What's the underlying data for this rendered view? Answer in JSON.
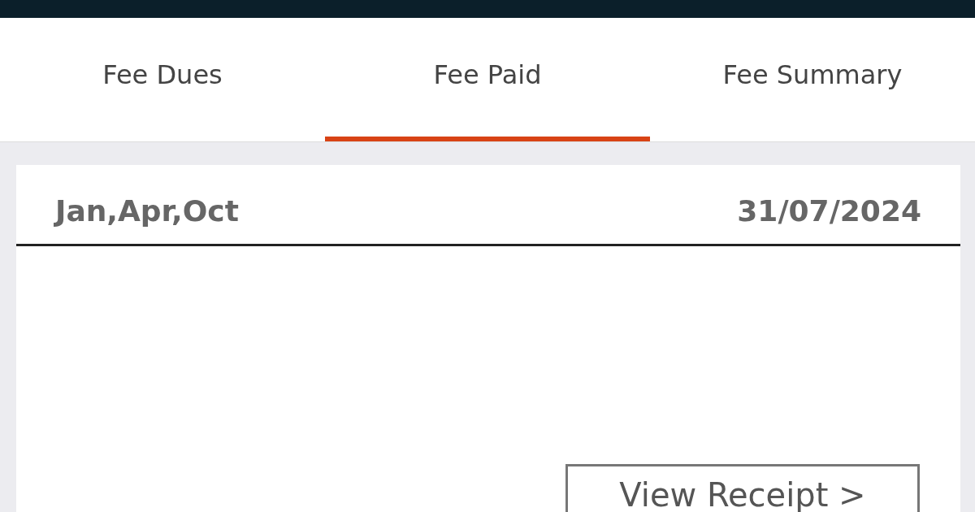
{
  "tabs": [
    {
      "label": "Fee Dues",
      "selected": false
    },
    {
      "label": "Fee Paid",
      "selected": true
    },
    {
      "label": "Fee Summary",
      "selected": false
    }
  ],
  "payment": {
    "months": "Jan,Apr,Oct",
    "date": "31/07/2024",
    "button": "View Receipt >"
  }
}
